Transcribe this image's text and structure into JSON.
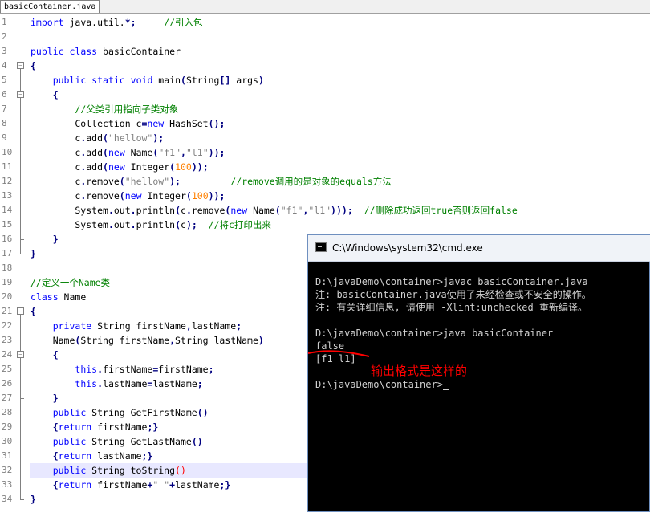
{
  "tab": {
    "label": "basicContainer.java"
  },
  "editor": {
    "lines": [
      {
        "n": "1",
        "segs": [
          {
            "t": "import",
            "c": "kw"
          },
          {
            "t": " java.util.",
            "c": ""
          },
          {
            "t": "*;",
            "c": "op"
          },
          {
            "t": "     ",
            "c": ""
          },
          {
            "t": "//引入包",
            "c": "cm"
          }
        ]
      },
      {
        "n": "2",
        "segs": []
      },
      {
        "n": "3",
        "segs": [
          {
            "t": "public",
            "c": "kw"
          },
          {
            "t": " ",
            "c": ""
          },
          {
            "t": "class",
            "c": "kw"
          },
          {
            "t": " basicContainer",
            "c": ""
          }
        ]
      },
      {
        "n": "4",
        "segs": [
          {
            "t": "{",
            "c": "op"
          }
        ]
      },
      {
        "n": "5",
        "segs": [
          {
            "t": "    ",
            "c": ""
          },
          {
            "t": "public",
            "c": "kw"
          },
          {
            "t": " ",
            "c": ""
          },
          {
            "t": "static",
            "c": "kw"
          },
          {
            "t": " ",
            "c": ""
          },
          {
            "t": "void",
            "c": "kw"
          },
          {
            "t": " main",
            "c": ""
          },
          {
            "t": "(",
            "c": "op"
          },
          {
            "t": "String",
            "c": ""
          },
          {
            "t": "[]",
            "c": "op"
          },
          {
            "t": " args",
            "c": ""
          },
          {
            "t": ")",
            "c": "op"
          }
        ]
      },
      {
        "n": "6",
        "segs": [
          {
            "t": "    ",
            "c": ""
          },
          {
            "t": "{",
            "c": "op"
          }
        ]
      },
      {
        "n": "7",
        "segs": [
          {
            "t": "        ",
            "c": ""
          },
          {
            "t": "//父类引用指向子类对象",
            "c": "cm"
          }
        ]
      },
      {
        "n": "8",
        "segs": [
          {
            "t": "        Collection c",
            "c": ""
          },
          {
            "t": "=",
            "c": "op"
          },
          {
            "t": "new",
            "c": "kw"
          },
          {
            "t": " HashSet",
            "c": ""
          },
          {
            "t": "();",
            "c": "op"
          }
        ]
      },
      {
        "n": "9",
        "segs": [
          {
            "t": "        c",
            "c": ""
          },
          {
            "t": ".",
            "c": "op"
          },
          {
            "t": "add",
            "c": ""
          },
          {
            "t": "(",
            "c": "op"
          },
          {
            "t": "\"hellow\"",
            "c": "str"
          },
          {
            "t": ");",
            "c": "op"
          }
        ]
      },
      {
        "n": "10",
        "segs": [
          {
            "t": "        c",
            "c": ""
          },
          {
            "t": ".",
            "c": "op"
          },
          {
            "t": "add",
            "c": ""
          },
          {
            "t": "(",
            "c": "op"
          },
          {
            "t": "new",
            "c": "kw"
          },
          {
            "t": " Name",
            "c": ""
          },
          {
            "t": "(",
            "c": "op"
          },
          {
            "t": "\"f1\"",
            "c": "str"
          },
          {
            "t": ",",
            "c": "op"
          },
          {
            "t": "\"l1\"",
            "c": "str"
          },
          {
            "t": "));",
            "c": "op"
          }
        ]
      },
      {
        "n": "11",
        "segs": [
          {
            "t": "        c",
            "c": ""
          },
          {
            "t": ".",
            "c": "op"
          },
          {
            "t": "add",
            "c": ""
          },
          {
            "t": "(",
            "c": "op"
          },
          {
            "t": "new",
            "c": "kw"
          },
          {
            "t": " Integer",
            "c": ""
          },
          {
            "t": "(",
            "c": "op"
          },
          {
            "t": "100",
            "c": "num"
          },
          {
            "t": "));",
            "c": "op"
          }
        ]
      },
      {
        "n": "12",
        "segs": [
          {
            "t": "        c",
            "c": ""
          },
          {
            "t": ".",
            "c": "op"
          },
          {
            "t": "remove",
            "c": ""
          },
          {
            "t": "(",
            "c": "op"
          },
          {
            "t": "\"hellow\"",
            "c": "str"
          },
          {
            "t": ");",
            "c": "op"
          },
          {
            "t": "         ",
            "c": ""
          },
          {
            "t": "//remove调用的是对象的equals方法",
            "c": "cm"
          }
        ]
      },
      {
        "n": "13",
        "segs": [
          {
            "t": "        c",
            "c": ""
          },
          {
            "t": ".",
            "c": "op"
          },
          {
            "t": "remove",
            "c": ""
          },
          {
            "t": "(",
            "c": "op"
          },
          {
            "t": "new",
            "c": "kw"
          },
          {
            "t": " Integer",
            "c": ""
          },
          {
            "t": "(",
            "c": "op"
          },
          {
            "t": "100",
            "c": "num"
          },
          {
            "t": "));",
            "c": "op"
          }
        ]
      },
      {
        "n": "14",
        "segs": [
          {
            "t": "        System",
            "c": ""
          },
          {
            "t": ".",
            "c": "op"
          },
          {
            "t": "out",
            "c": ""
          },
          {
            "t": ".",
            "c": "op"
          },
          {
            "t": "println",
            "c": ""
          },
          {
            "t": "(",
            "c": "op"
          },
          {
            "t": "c",
            "c": ""
          },
          {
            "t": ".",
            "c": "op"
          },
          {
            "t": "remove",
            "c": ""
          },
          {
            "t": "(",
            "c": "op"
          },
          {
            "t": "new",
            "c": "kw"
          },
          {
            "t": " Name",
            "c": ""
          },
          {
            "t": "(",
            "c": "op"
          },
          {
            "t": "\"f1\"",
            "c": "str"
          },
          {
            "t": ",",
            "c": "op"
          },
          {
            "t": "\"l1\"",
            "c": "str"
          },
          {
            "t": ")));",
            "c": "op"
          },
          {
            "t": "  ",
            "c": ""
          },
          {
            "t": "//删除成功返回true否则返回false",
            "c": "cm"
          }
        ]
      },
      {
        "n": "15",
        "segs": [
          {
            "t": "        System",
            "c": ""
          },
          {
            "t": ".",
            "c": "op"
          },
          {
            "t": "out",
            "c": ""
          },
          {
            "t": ".",
            "c": "op"
          },
          {
            "t": "println",
            "c": ""
          },
          {
            "t": "(",
            "c": "op"
          },
          {
            "t": "c",
            "c": ""
          },
          {
            "t": ");",
            "c": "op"
          },
          {
            "t": "  ",
            "c": ""
          },
          {
            "t": "//将c打印出来",
            "c": "cm"
          }
        ]
      },
      {
        "n": "16",
        "segs": [
          {
            "t": "    ",
            "c": ""
          },
          {
            "t": "}",
            "c": "op"
          }
        ]
      },
      {
        "n": "17",
        "segs": [
          {
            "t": "}",
            "c": "op"
          }
        ]
      },
      {
        "n": "18",
        "segs": []
      },
      {
        "n": "19",
        "segs": [
          {
            "t": "//定义一个Name类",
            "c": "cm"
          }
        ]
      },
      {
        "n": "20",
        "segs": [
          {
            "t": "class",
            "c": "kw"
          },
          {
            "t": " Name",
            "c": ""
          }
        ]
      },
      {
        "n": "21",
        "segs": [
          {
            "t": "{",
            "c": "op"
          }
        ]
      },
      {
        "n": "22",
        "segs": [
          {
            "t": "    ",
            "c": ""
          },
          {
            "t": "private",
            "c": "kw"
          },
          {
            "t": " String firstName",
            "c": ""
          },
          {
            "t": ",",
            "c": "op"
          },
          {
            "t": "lastName",
            "c": ""
          },
          {
            "t": ";",
            "c": "op"
          }
        ]
      },
      {
        "n": "23",
        "segs": [
          {
            "t": "    Name",
            "c": ""
          },
          {
            "t": "(",
            "c": "op"
          },
          {
            "t": "String firstName",
            "c": ""
          },
          {
            "t": ",",
            "c": "op"
          },
          {
            "t": "String lastName",
            "c": ""
          },
          {
            "t": ")",
            "c": "op"
          }
        ]
      },
      {
        "n": "24",
        "segs": [
          {
            "t": "    ",
            "c": ""
          },
          {
            "t": "{",
            "c": "op"
          }
        ]
      },
      {
        "n": "25",
        "segs": [
          {
            "t": "        ",
            "c": ""
          },
          {
            "t": "this",
            "c": "kw"
          },
          {
            "t": ".",
            "c": "op"
          },
          {
            "t": "firstName",
            "c": ""
          },
          {
            "t": "=",
            "c": "op"
          },
          {
            "t": "firstName",
            "c": ""
          },
          {
            "t": ";",
            "c": "op"
          }
        ]
      },
      {
        "n": "26",
        "segs": [
          {
            "t": "        ",
            "c": ""
          },
          {
            "t": "this",
            "c": "kw"
          },
          {
            "t": ".",
            "c": "op"
          },
          {
            "t": "lastName",
            "c": ""
          },
          {
            "t": "=",
            "c": "op"
          },
          {
            "t": "lastName",
            "c": ""
          },
          {
            "t": ";",
            "c": "op"
          }
        ]
      },
      {
        "n": "27",
        "segs": [
          {
            "t": "    ",
            "c": ""
          },
          {
            "t": "}",
            "c": "op"
          }
        ]
      },
      {
        "n": "28",
        "segs": [
          {
            "t": "    ",
            "c": ""
          },
          {
            "t": "public",
            "c": "kw"
          },
          {
            "t": " String GetFirstName",
            "c": ""
          },
          {
            "t": "()",
            "c": "op"
          }
        ]
      },
      {
        "n": "29",
        "segs": [
          {
            "t": "    ",
            "c": ""
          },
          {
            "t": "{",
            "c": "op"
          },
          {
            "t": "return",
            "c": "kw"
          },
          {
            "t": " firstName",
            "c": ""
          },
          {
            "t": ";}",
            "c": "op"
          }
        ]
      },
      {
        "n": "30",
        "segs": [
          {
            "t": "    ",
            "c": ""
          },
          {
            "t": "public",
            "c": "kw"
          },
          {
            "t": " String GetLastName",
            "c": ""
          },
          {
            "t": "()",
            "c": "op"
          }
        ]
      },
      {
        "n": "31",
        "segs": [
          {
            "t": "    ",
            "c": ""
          },
          {
            "t": "{",
            "c": "op"
          },
          {
            "t": "return",
            "c": "kw"
          },
          {
            "t": " lastName",
            "c": ""
          },
          {
            "t": ";}",
            "c": "op"
          }
        ]
      },
      {
        "n": "32",
        "hl": true,
        "segs": [
          {
            "t": "    ",
            "c": ""
          },
          {
            "t": "public",
            "c": "kw"
          },
          {
            "t": " String toString",
            "c": ""
          },
          {
            "t": "()",
            "c": "red"
          }
        ]
      },
      {
        "n": "33",
        "segs": [
          {
            "t": "    ",
            "c": ""
          },
          {
            "t": "{",
            "c": "op"
          },
          {
            "t": "return",
            "c": "kw"
          },
          {
            "t": " firstName",
            "c": ""
          },
          {
            "t": "+",
            "c": "op"
          },
          {
            "t": "\" \"",
            "c": "str"
          },
          {
            "t": "+",
            "c": "op"
          },
          {
            "t": "lastName",
            "c": ""
          },
          {
            "t": ";}",
            "c": "op"
          }
        ]
      },
      {
        "n": "34",
        "segs": [
          {
            "t": "}",
            "c": "op"
          }
        ]
      }
    ]
  },
  "cmd": {
    "title": "C:\\Windows\\system32\\cmd.exe",
    "lines": [
      "",
      "D:\\javaDemo\\container>javac basicContainer.java",
      "注: basicContainer.java使用了未经检查或不安全的操作。",
      "注: 有关详细信息, 请使用 -Xlint:unchecked 重新编译。",
      "",
      "D:\\javaDemo\\container>java basicContainer",
      "false",
      "[f1 l1]",
      "",
      "D:\\javaDemo\\container>"
    ]
  },
  "annotation": {
    "text": "输出格式是这样的",
    "color": "#ff0000"
  },
  "colors": {
    "keyword": "#0000ff",
    "comment": "#008000",
    "string": "#808080",
    "number": "#ff8000",
    "cmd_bg": "#000000",
    "highlight_line": "#e8e8ff"
  }
}
